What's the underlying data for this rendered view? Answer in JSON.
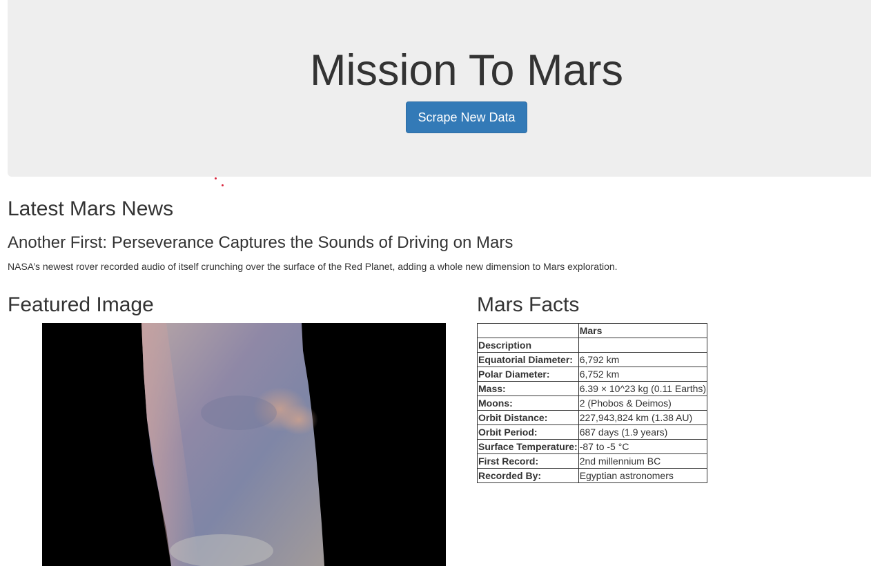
{
  "header": {
    "title": "Mission To Mars",
    "scrape_button": "Scrape New Data"
  },
  "news": {
    "heading": "Latest Mars News",
    "title": "Another First: Perseverance Captures the Sounds of Driving on Mars",
    "paragraph": "NASA’s newest rover recorded audio of itself crunching over the surface of the Red Planet, adding a whole new dimension to Mars exploration."
  },
  "featured": {
    "heading": "Featured Image"
  },
  "facts": {
    "heading": "Mars Facts",
    "columns": [
      "",
      "Mars"
    ],
    "rows": [
      {
        "label": "Description",
        "value": ""
      },
      {
        "label": "Equatorial Diameter:",
        "value": "6,792 km"
      },
      {
        "label": "Polar Diameter:",
        "value": "6,752 km"
      },
      {
        "label": "Mass:",
        "value": "6.39 × 10^23 kg (0.11 Earths)"
      },
      {
        "label": "Moons:",
        "value": "2 (Phobos & Deimos)"
      },
      {
        "label": "Orbit Distance:",
        "value": "227,943,824 km (1.38 AU)"
      },
      {
        "label": "Orbit Period:",
        "value": "687 days (1.9 years)"
      },
      {
        "label": "Surface Temperature:",
        "value": "-87 to -5 °C"
      },
      {
        "label": "First Record:",
        "value": "2nd millennium BC"
      },
      {
        "label": "Recorded By:",
        "value": "Egyptian astronomers"
      }
    ]
  },
  "colors": {
    "jumbotron_bg": "#eeeeee",
    "button_bg": "#337ab7",
    "text": "#333333"
  }
}
